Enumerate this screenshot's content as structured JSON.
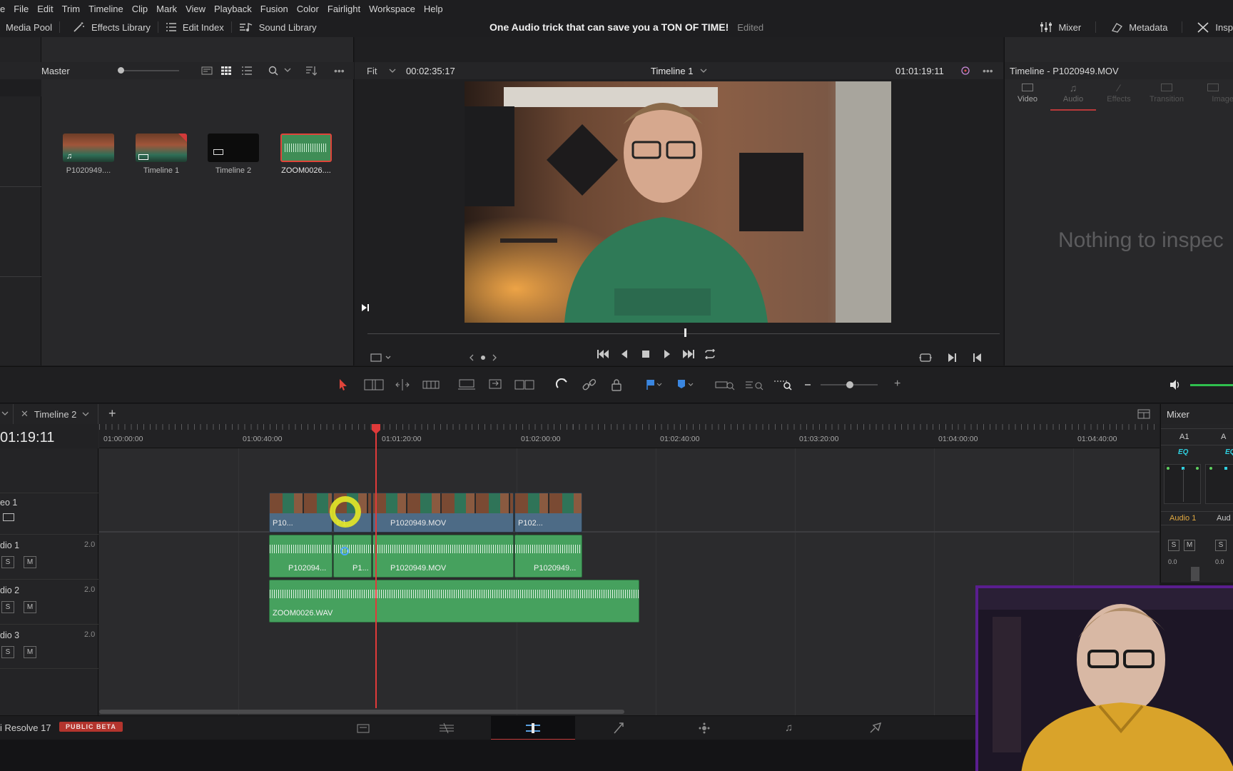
{
  "menu": [
    "e",
    "File",
    "Edit",
    "Trim",
    "Timeline",
    "Clip",
    "Mark",
    "View",
    "Playback",
    "Fusion",
    "Color",
    "Fairlight",
    "Workspace",
    "Help"
  ],
  "toolbar": {
    "media_pool": "Media Pool",
    "effects_library": "Effects Library",
    "edit_index": "Edit Index",
    "sound_library": "Sound Library",
    "project_title": "One Audio trick that can save you a TON OF TIME!",
    "edited": "Edited",
    "mixer": "Mixer",
    "metadata": "Metadata",
    "inspector": "Insp"
  },
  "media_pool": {
    "folder": "Master",
    "clips": [
      {
        "label": "P1020949...."
      },
      {
        "label": "Timeline 1"
      },
      {
        "label": "Timeline 2"
      },
      {
        "label": "ZOOM0026...."
      }
    ]
  },
  "viewer": {
    "zoom": "Fit",
    "source_tc": "00:02:35:17",
    "timeline_name": "Timeline 1",
    "record_tc": "01:01:19:11"
  },
  "inspector": {
    "title": "Timeline - P1020949.MOV",
    "tabs": [
      "Video",
      "Audio",
      "Effects",
      "Transition",
      "Image"
    ],
    "empty": "Nothing to inspec"
  },
  "timeline": {
    "tab": "Timeline 2",
    "timecode": "01:19:11",
    "ruler": [
      "01:00:00:00",
      "01:00:40:00",
      "01:01:20:00",
      "01:02:00:00",
      "01:02:40:00",
      "01:03:20:00",
      "01:04:00:00",
      "01:04:40:00"
    ],
    "tracks": [
      {
        "name": "eo 1",
        "channels": ""
      },
      {
        "name": "dio 1",
        "channels": "2.0"
      },
      {
        "name": "dio 2",
        "channels": "2.0"
      },
      {
        "name": "dio 3",
        "channels": "2.0"
      }
    ],
    "video_clips": [
      "P10...",
      "P1...",
      "P1020949.MOV",
      "P102..."
    ],
    "audio1_clips": [
      "P102094...",
      "P1...",
      "P1020949.MOV",
      "P1020949..."
    ],
    "audio2_clip": "ZOOM0026.WAV",
    "solo": "S",
    "mute": "M"
  },
  "mixer": {
    "title": "Mixer",
    "ch1": "A1",
    "ch2": "A",
    "eq": "EQ",
    "audio1": "Audio 1",
    "audio2": "Aud",
    "level1": "0.0",
    "level2": "0.0"
  },
  "footer": {
    "app": "i Resolve 17",
    "badge": "PUBLIC BETA"
  }
}
